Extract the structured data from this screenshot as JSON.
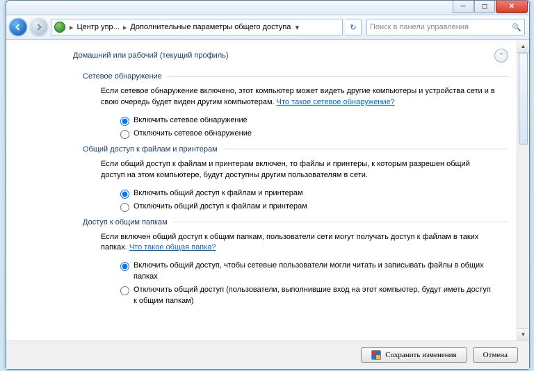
{
  "breadcrumb": {
    "root": "Центр упр...",
    "current": "Дополнительные параметры общего доступа"
  },
  "search": {
    "placeholder": "Поиск в панели управления"
  },
  "profile": {
    "title": "Домашний или рабочий (текущий профиль)"
  },
  "sections": {
    "discovery": {
      "title": "Сетевое обнаружение",
      "text_before": "Если сетевое обнаружение включено, этот компьютер может видеть другие компьютеры и устройства сети и в свою очередь будет виден другим компьютерам. ",
      "link": "Что такое сетевое обнаружение?",
      "opt_on": "Включить сетевое обнаружение",
      "opt_off": "Отключить сетевое обнаружение"
    },
    "fileshare": {
      "title": "Общий доступ к файлам и принтерам",
      "text": "Если общий доступ к файлам и принтерам включен, то файлы и принтеры, к которым разрешен общий доступ на этом компьютере, будут доступны другим пользователям в сети.",
      "opt_on": "Включить общий доступ к файлам и принтерам",
      "opt_off": "Отключить общий доступ к файлам и принтерам"
    },
    "public": {
      "title": "Доступ к общим папкам",
      "text_before": "Если включен общий доступ к общим папкам, пользователи сети могут получать доступ к файлам в таких папках. ",
      "link": "Что такое общая папка?",
      "opt_on": "Включить общий доступ, чтобы сетевые пользователи могли читать и записывать файлы в общих папках",
      "opt_off": "Отключить общий доступ (пользователи, выполнившие вход на этот компьютер, будут иметь доступ к общим папкам)"
    }
  },
  "footer": {
    "save": "Сохранить изменения",
    "cancel": "Отмена"
  }
}
